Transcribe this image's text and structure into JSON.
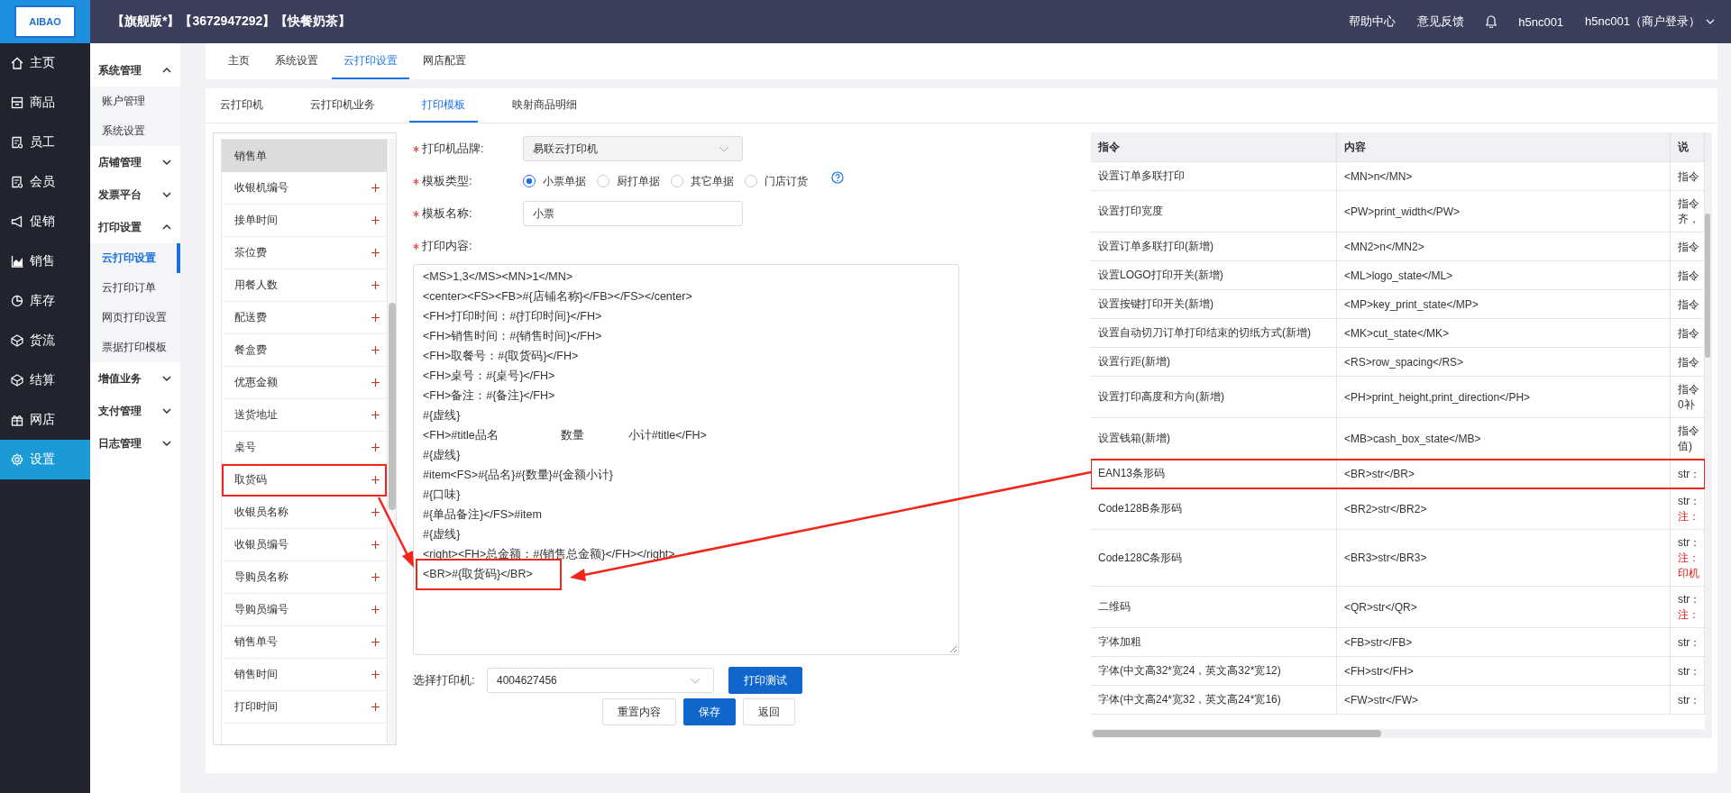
{
  "topbar": {
    "logo": "AIBAO",
    "title": "【旗舰版*】【3672947292】【快餐奶茶】",
    "links": [
      "帮助中心",
      "意见反馈"
    ],
    "user": "h5nc001",
    "account": "h5nc001（商户登录）"
  },
  "nav": [
    {
      "kind": "home",
      "label": "主页",
      "selected": false
    },
    {
      "kind": "box",
      "label": "商品",
      "selected": false
    },
    {
      "kind": "badge",
      "label": "员工",
      "selected": false
    },
    {
      "kind": "badge",
      "label": "会员",
      "selected": false
    },
    {
      "kind": "horn",
      "label": "促销",
      "selected": false
    },
    {
      "kind": "chart",
      "label": "销售",
      "selected": false
    },
    {
      "kind": "pie",
      "label": "库存",
      "selected": false
    },
    {
      "kind": "cube",
      "label": "货流",
      "selected": false
    },
    {
      "kind": "cube",
      "label": "结算",
      "selected": false
    },
    {
      "kind": "gift",
      "label": "网店",
      "selected": false
    },
    {
      "kind": "gear",
      "label": "设置",
      "selected": true
    }
  ],
  "menu": [
    {
      "label": "系统管理",
      "expanded": true,
      "children": [
        {
          "label": "账户管理",
          "selected": false
        },
        {
          "label": "系统设置",
          "selected": false
        }
      ]
    },
    {
      "label": "店铺管理",
      "expanded": false
    },
    {
      "label": "发票平台",
      "expanded": false
    },
    {
      "label": "打印设置",
      "expanded": true,
      "children": [
        {
          "label": "云打印设置",
          "selected": true
        },
        {
          "label": "云打印订单",
          "selected": false
        },
        {
          "label": "网页打印设置",
          "selected": false
        },
        {
          "label": "票据打印模板",
          "selected": false
        }
      ]
    },
    {
      "label": "增值业务",
      "expanded": false
    },
    {
      "label": "支付管理",
      "expanded": false
    },
    {
      "label": "日志管理",
      "expanded": false
    }
  ],
  "tabs": [
    {
      "label": "主页",
      "selected": false
    },
    {
      "label": "系统设置",
      "selected": false
    },
    {
      "label": "云打印设置",
      "selected": true
    },
    {
      "label": "网店配置",
      "selected": false
    }
  ],
  "subtabs": [
    {
      "label": "云打印机",
      "selected": false
    },
    {
      "label": "云打印机业务",
      "selected": false
    },
    {
      "label": "打印模板",
      "selected": true
    },
    {
      "label": "映射商品明细",
      "selected": false
    }
  ],
  "fields": {
    "header": "销售单",
    "items": [
      {
        "label": "收银机编号",
        "highlighted": false
      },
      {
        "label": "接单时间",
        "highlighted": false
      },
      {
        "label": "茶位费",
        "highlighted": false
      },
      {
        "label": "用餐人数",
        "highlighted": false
      },
      {
        "label": "配送费",
        "highlighted": false
      },
      {
        "label": "餐盒费",
        "highlighted": false
      },
      {
        "label": "优惠金额",
        "highlighted": false
      },
      {
        "label": "送货地址",
        "highlighted": false
      },
      {
        "label": "桌号",
        "highlighted": false
      },
      {
        "label": "取货码",
        "highlighted": true
      },
      {
        "label": "收银员名称",
        "highlighted": false
      },
      {
        "label": "收银员编号",
        "highlighted": false
      },
      {
        "label": "导购员名称",
        "highlighted": false
      },
      {
        "label": "导购员编号",
        "highlighted": false
      },
      {
        "label": "销售单号",
        "highlighted": false
      },
      {
        "label": "销售时间",
        "highlighted": false
      },
      {
        "label": "打印时间",
        "highlighted": false
      }
    ]
  },
  "form": {
    "brand": {
      "label": "打印机品牌:",
      "required": true,
      "value": "易联云打印机",
      "disabled": true
    },
    "type": {
      "label": "模板类型:",
      "required": true,
      "options": [
        {
          "label": "小票单据",
          "selected": true
        },
        {
          "label": "厨打单据",
          "selected": false
        },
        {
          "label": "其它单据",
          "selected": false
        },
        {
          "label": "门店订货",
          "selected": false
        }
      ]
    },
    "name": {
      "label": "模板名称:",
      "required": true,
      "value": "小票"
    },
    "content": {
      "label": "打印内容:",
      "required": true,
      "lines": [
        {
          "text": "<MS>1,3</MS><MN>1</MN>",
          "highlighted": false
        },
        {
          "text": "<center><FS><FB>#{店铺名称}</FB></FS></center>",
          "highlighted": false
        },
        {
          "text": "<FH>打印时间：#{打印时间}</FH>",
          "highlighted": false
        },
        {
          "text": "<FH>销售时间：#{销售时间}</FH>",
          "highlighted": false
        },
        {
          "text": "<FH>取餐号：#{取货码}</FH>",
          "highlighted": false
        },
        {
          "text": "<FH>桌号：#{桌号}</FH>",
          "highlighted": false
        },
        {
          "text": "<FH>备注：#{备注}</FH>",
          "highlighted": false
        },
        {
          "text": "#{虚线}",
          "highlighted": false
        },
        {
          "text": "<FH>#title品名                    数量              小计#title</FH>",
          "highlighted": false
        },
        {
          "text": "#{虚线}",
          "highlighted": false
        },
        {
          "text": "#item<FS>#{品名}#{数量}#{金额小计}",
          "highlighted": false
        },
        {
          "text": "#{口味}",
          "highlighted": false
        },
        {
          "text": "#{单品备注}</FS>#item",
          "highlighted": false
        },
        {
          "text": "#{虚线}",
          "highlighted": false
        },
        {
          "text": "<right><FH>总金额：#{销售总金额}</FH></right>",
          "highlighted": false
        },
        {
          "text": "<BR>#{取货码}</BR>",
          "highlighted": true
        }
      ]
    },
    "printer": {
      "label": "选择打印机:",
      "value": "4004627456"
    },
    "test_button": "打印测试",
    "buttons": [
      {
        "label": "重置内容",
        "primary": false
      },
      {
        "label": "保存",
        "primary": true
      },
      {
        "label": "返回",
        "primary": false
      }
    ]
  },
  "table": {
    "columns": [
      "指令",
      "内容",
      "说"
    ],
    "rows": [
      {
        "command": "设置订单多联打印",
        "content": "<MN>n</MN>",
        "notes": [
          {
            "text": "指令",
            "red": false
          }
        ],
        "highlighted": false
      },
      {
        "command": "设置打印宽度",
        "content": "<PW>print_width</PW>",
        "notes": [
          {
            "text": "指令",
            "red": false
          },
          {
            "text": "齐，",
            "red": false
          }
        ],
        "highlighted": false
      },
      {
        "command": "设置订单多联打印(新增)",
        "content": "<MN2>n</MN2>",
        "notes": [
          {
            "text": "指令",
            "red": false
          }
        ],
        "highlighted": false
      },
      {
        "command": "设置LOGO打印开关(新增)",
        "content": "<ML>logo_state</ML>",
        "notes": [
          {
            "text": "指令",
            "red": false
          }
        ],
        "highlighted": false
      },
      {
        "command": "设置按键打印开关(新增)",
        "content": "<MP>key_print_state</MP>",
        "notes": [
          {
            "text": "指令",
            "red": false
          }
        ],
        "highlighted": false
      },
      {
        "command": "设置自动切刀订单打印结束的切纸方式(新增)",
        "content": "<MK>cut_state</MK>",
        "notes": [
          {
            "text": "指令",
            "red": false
          }
        ],
        "highlighted": false
      },
      {
        "command": "设置行距(新增)",
        "content": "<RS>row_spacing</RS>",
        "notes": [
          {
            "text": "指令",
            "red": false
          }
        ],
        "highlighted": false
      },
      {
        "command": "设置打印高度和方向(新增)",
        "content": "<PH>print_height,print_direction</PH>",
        "notes": [
          {
            "text": "指令",
            "red": false
          },
          {
            "text": "0补",
            "red": false
          }
        ],
        "highlighted": false
      },
      {
        "command": "设置钱箱(新增)",
        "content": "<MB>cash_box_state</MB>",
        "notes": [
          {
            "text": "指令",
            "red": false
          },
          {
            "text": "值)",
            "red": false
          }
        ],
        "highlighted": false
      },
      {
        "command": "EAN13条形码",
        "content": "<BR>str</BR>",
        "notes": [
          {
            "text": "str：",
            "red": false
          }
        ],
        "highlighted": true
      },
      {
        "command": "Code128B条形码",
        "content": "<BR2>str</BR2>",
        "notes": [
          {
            "text": "str：",
            "red": false
          },
          {
            "text": "注：",
            "red": true
          }
        ],
        "highlighted": false
      },
      {
        "command": "Code128C条形码",
        "content": "<BR3>str</BR3>",
        "notes": [
          {
            "text": "str：",
            "red": false
          },
          {
            "text": "注：",
            "red": true
          },
          {
            "text": "印机",
            "red": true
          }
        ],
        "highlighted": false
      },
      {
        "command": "二维码",
        "content": "<QR>str</QR>",
        "notes": [
          {
            "text": "str：",
            "red": false
          },
          {
            "text": "注：",
            "red": true
          }
        ],
        "highlighted": false
      },
      {
        "command": "字体加粗",
        "content": "<FB>str</FB>",
        "notes": [
          {
            "text": "str：",
            "red": false
          }
        ],
        "highlighted": false
      },
      {
        "command": "字体(中文高32*宽24，英文高32*宽12)",
        "content": "<FH>str</FH>",
        "notes": [
          {
            "text": "str：",
            "red": false
          }
        ],
        "highlighted": false
      },
      {
        "command": "字体(中文高24*宽32，英文高24*宽16)",
        "content": "<FW>str</FW>",
        "notes": [
          {
            "text": "str：",
            "red": false
          }
        ],
        "highlighted": false
      }
    ]
  }
}
